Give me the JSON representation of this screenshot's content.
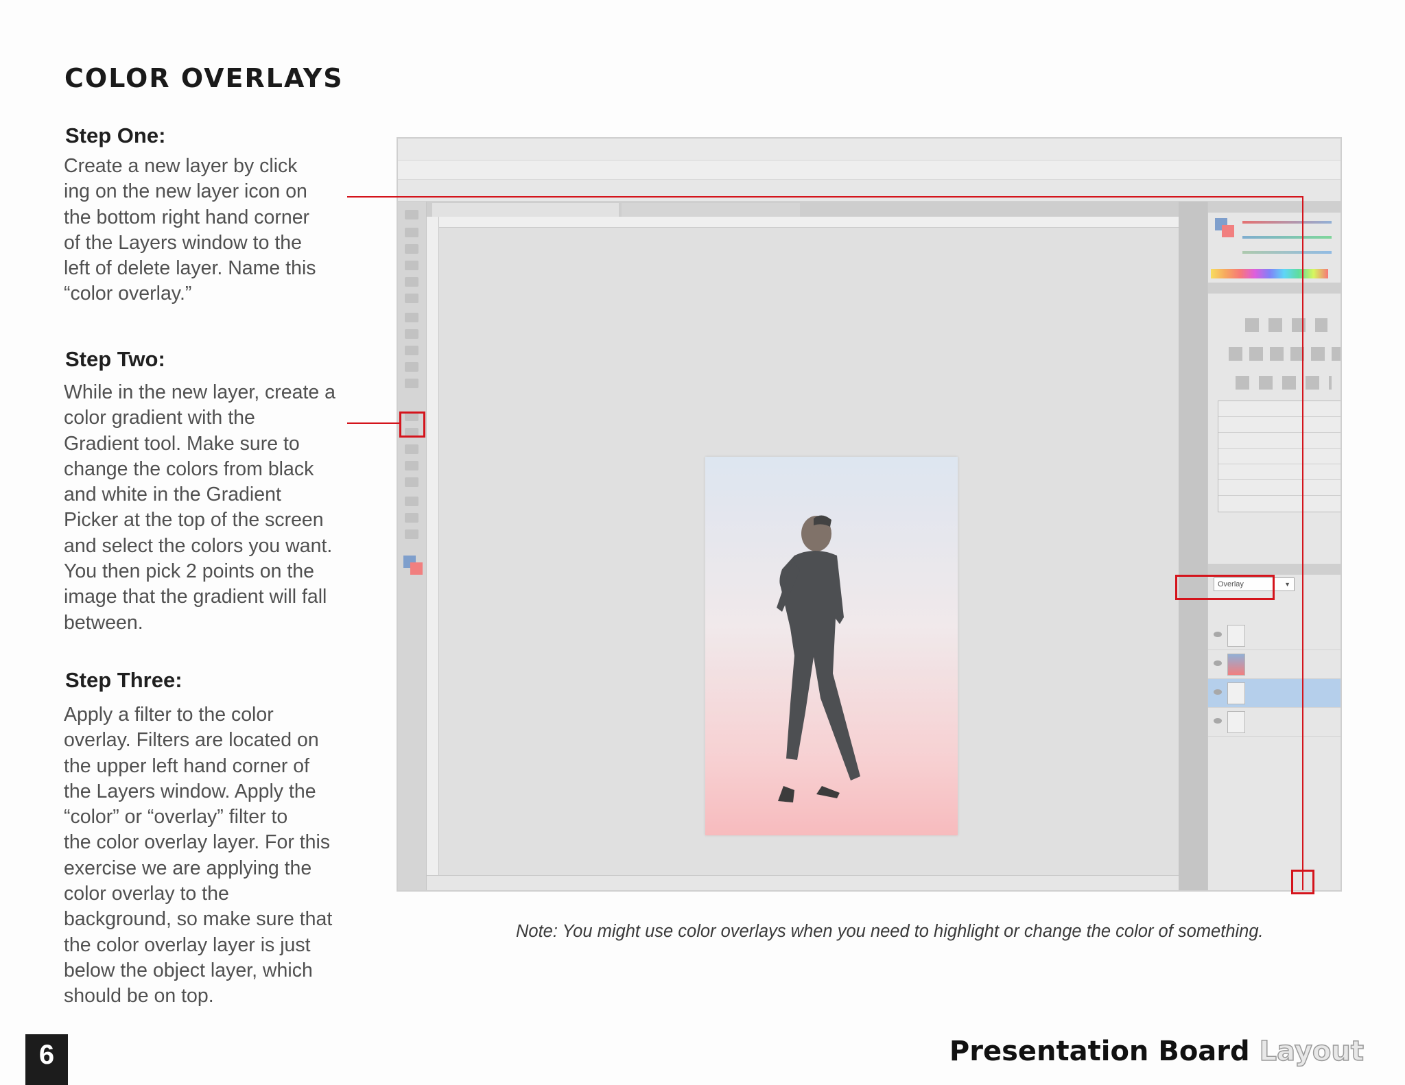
{
  "page": {
    "title": "COLOR OVERLAYS",
    "page_number": "6",
    "footer_strong": "Presentation Board",
    "footer_light": "Layout",
    "note": "Note: You might use color overlays when you need to highlight or change the color of something."
  },
  "steps": [
    {
      "heading": "Step One:",
      "body": "Create a new layer by click\ning on the new layer icon on\nthe bottom right hand corner\nof the Layers window to the\nleft of delete layer. Name this\n“color overlay.”"
    },
    {
      "heading": "Step Two:",
      "body": "While in the new layer, create a\ncolor gradient with the\nGradient tool. Make sure to\nchange the colors from black\nand white in the Gradient\nPicker at the top of the screen\nand select the colors you want.\nYou then pick 2 points on the\nimage that the gradient will fall\nbetween."
    },
    {
      "heading": "Step Three:",
      "body": "Apply a filter to the color\noverlay. Filters are located on\nthe upper left hand corner of\nthe Layers window. Apply the\n“color” or “overlay” filter to\nthe color overlay layer. For this\nexercise we are applying the\ncolor overlay to the\nbackground, so make sure that\nthe color overlay layer is just\nbelow the object layer, which\nshould be on top."
    }
  ],
  "screenshot": {
    "blend_mode": "Overlay",
    "colors": {
      "highlight": "#d4141c",
      "selected_layer": "#a9c7e8"
    }
  }
}
